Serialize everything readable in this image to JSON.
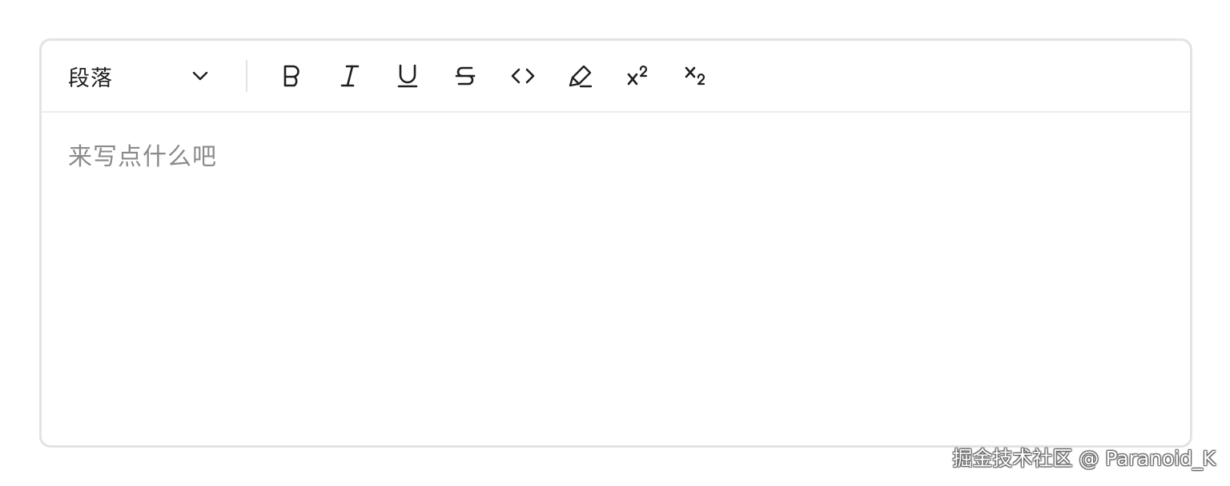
{
  "toolbar": {
    "block_type": {
      "selected": "段落",
      "icon": "chevron-down-icon"
    },
    "buttons": [
      {
        "name": "bold",
        "icon": "bold-icon"
      },
      {
        "name": "italic",
        "icon": "italic-icon"
      },
      {
        "name": "underline",
        "icon": "underline-icon"
      },
      {
        "name": "strikethrough",
        "icon": "strikethrough-icon"
      },
      {
        "name": "code",
        "icon": "code-icon"
      },
      {
        "name": "highlight",
        "icon": "highlighter-icon"
      },
      {
        "name": "superscript",
        "icon": "superscript-icon"
      },
      {
        "name": "subscript",
        "icon": "subscript-icon"
      }
    ]
  },
  "editor": {
    "placeholder": "来写点什么吧"
  },
  "watermark": {
    "text": "掘金技术社区 @ Paranoid_K"
  },
  "colors": {
    "border": "#e3e3e3",
    "icon": "#1f1f1f",
    "placeholder": "#8a8a8a"
  }
}
